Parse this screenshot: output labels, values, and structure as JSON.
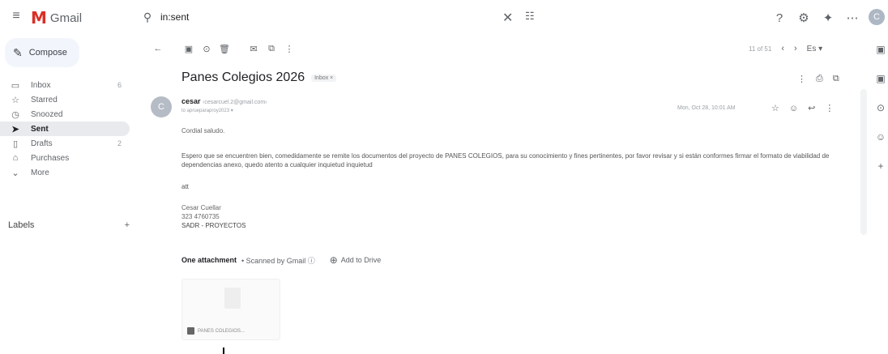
{
  "app": {
    "name": "Gmail",
    "logo_letter": "M"
  },
  "search": {
    "value": "in:sent"
  },
  "icons": {
    "menu": "≡",
    "search": "⚲",
    "clear": "✕",
    "tune": "☷",
    "help": "?",
    "settings": "⚙",
    "gemini": "✦",
    "apps": "⋯",
    "pen": "✎",
    "back": "←",
    "archive": "▣",
    "report": "⊙",
    "delete": "🗑",
    "mark": "✉",
    "move": "⧉",
    "more": "⋮",
    "prev": "‹",
    "next": "›",
    "print": "⎙",
    "open": "⧉",
    "star": "☆",
    "emoji": "☺",
    "reply": "↩",
    "drive": "⊕",
    "add": "+"
  },
  "user": {
    "avatar_letter": "C"
  },
  "compose": {
    "label": "Compose"
  },
  "sidebar": {
    "items": [
      {
        "label": "Inbox",
        "icon": "▭",
        "count": "6"
      },
      {
        "label": "Starred",
        "icon": "☆",
        "count": ""
      },
      {
        "label": "Snoozed",
        "icon": "◷",
        "count": ""
      },
      {
        "label": "Sent",
        "icon": "➤",
        "count": ""
      },
      {
        "label": "Drafts",
        "icon": "▯",
        "count": "2"
      },
      {
        "label": "Purchases",
        "icon": "⌂",
        "count": ""
      },
      {
        "label": "More",
        "icon": "⌄",
        "count": ""
      }
    ],
    "labels_heading": "Labels"
  },
  "pager": {
    "position": "11 of 51",
    "language": "Es ▾"
  },
  "email": {
    "subject": "Panes Colegios 2026",
    "label_chip": "Inbox ×",
    "sender_name": "cesar",
    "sender_email": "‹cesarcuel.2@gmail.com›",
    "to_line": "to aprueparaproy2023 ▾",
    "date": "Mon, Oct 28, 10:01 AM",
    "greeting": "Cordial saludo.",
    "paragraph": "Espero que se encuentren bien, comedidamente se remite los documentos  del proyecto de PANES COLEGIOS, para su conocimiento y fines pertinentes, por favor revisar y si están conformes firmar el formato de viabilidad de dependencias anexo, quedo atento a cualquier inquietud inquietud",
    "att": "att",
    "sig_name": "Cesar Cuellar",
    "sig_phone": "323 4760735",
    "sig_dept": "SADR - PROYECTOS"
  },
  "attachments": {
    "heading": "One attachment",
    "scanned": "• Scanned by Gmail ⓘ",
    "add_drive": "Add to Drive",
    "file_name": "PANES COLEGIOS..."
  }
}
